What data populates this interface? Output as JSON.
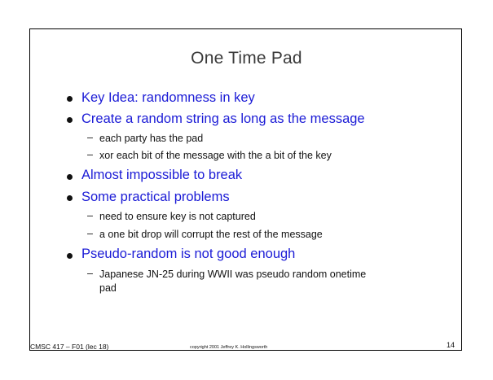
{
  "slide": {
    "title": "One Time Pad",
    "bullets": [
      {
        "text": "Key Idea: randomness in key",
        "subs": []
      },
      {
        "text": "Create a random string as long as the message",
        "subs": [
          "each party has the pad",
          "xor each bit of the message with the a bit of the key"
        ]
      },
      {
        "text": "Almost impossible to break",
        "subs": []
      },
      {
        "text": "Some practical problems",
        "subs": [
          "need to ensure key is not captured",
          "a one bit drop will corrupt the rest of the message"
        ]
      },
      {
        "text": "Pseudo-random is not good enough",
        "subs": [
          "Japanese JN-25 during WWII was pseudo random onetime",
          "pad"
        ]
      }
    ],
    "dash": "–"
  },
  "footer": {
    "course": "CMSC 417 – F01  (lec 18)",
    "copyright": "copyright 2001  Jeffrey K. Hollingsworth",
    "page_number": "14"
  }
}
